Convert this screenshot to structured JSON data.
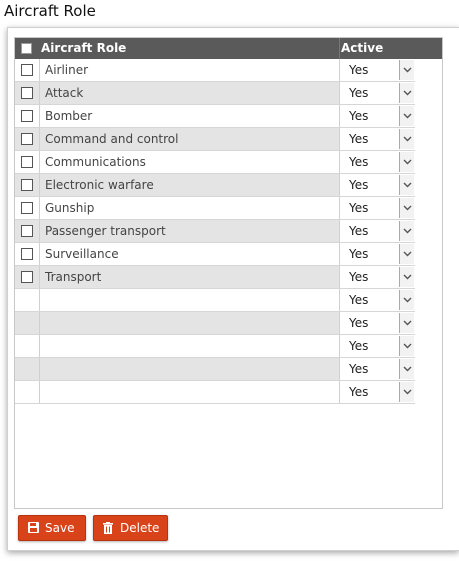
{
  "page": {
    "title": "Aircraft Role"
  },
  "grid": {
    "columns": {
      "role": "Aircraft Role",
      "active": "Active"
    },
    "rows": [
      {
        "role": "Airliner",
        "active": "Yes"
      },
      {
        "role": "Attack",
        "active": "Yes"
      },
      {
        "role": "Bomber",
        "active": "Yes"
      },
      {
        "role": "Command and control",
        "active": "Yes"
      },
      {
        "role": "Communications",
        "active": "Yes"
      },
      {
        "role": "Electronic warfare",
        "active": "Yes"
      },
      {
        "role": "Gunship",
        "active": "Yes"
      },
      {
        "role": "Passenger transport",
        "active": "Yes"
      },
      {
        "role": "Surveillance",
        "active": "Yes"
      },
      {
        "role": "Transport",
        "active": "Yes"
      },
      {
        "role": "",
        "active": "Yes"
      },
      {
        "role": "",
        "active": "Yes"
      },
      {
        "role": "",
        "active": "Yes"
      },
      {
        "role": "",
        "active": "Yes"
      },
      {
        "role": "",
        "active": "Yes"
      }
    ],
    "checkbox_rows": 10
  },
  "toolbar": {
    "save_label": "Save",
    "delete_label": "Delete"
  },
  "icons": {
    "save": "floppy-disk-icon",
    "delete": "trash-icon",
    "dropdown": "chevron-down-icon"
  },
  "colors": {
    "header_bg": "#5a5a5a",
    "button_bg": "#d9431a",
    "row_alt": "#e4e4e4"
  }
}
